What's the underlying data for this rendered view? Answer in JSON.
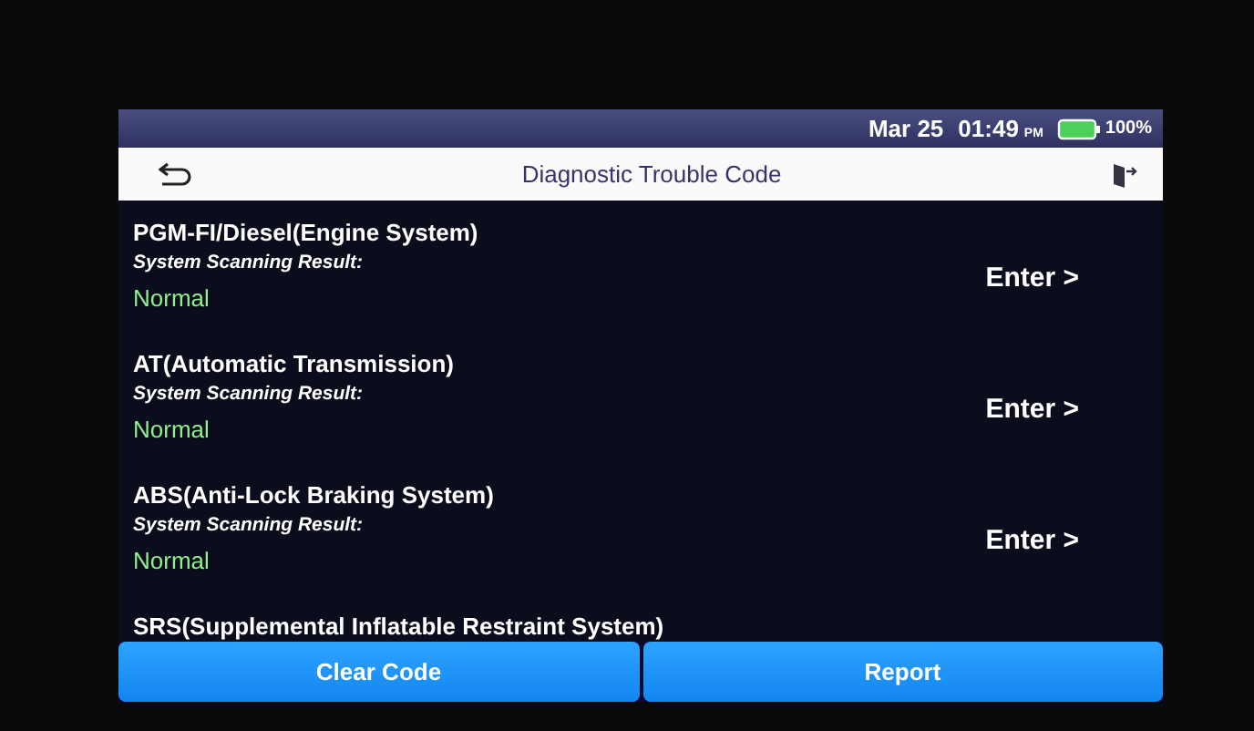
{
  "status_bar": {
    "date": "Mar 25",
    "time": "01:49",
    "meridiem": "PM",
    "battery_level": "100%"
  },
  "header": {
    "title": "Diagnostic Trouble Code"
  },
  "systems": [
    {
      "name": "PGM-FI/Diesel(Engine System)",
      "result_label": "System Scanning Result:",
      "result": "Normal",
      "action": "Enter >"
    },
    {
      "name": "AT(Automatic Transmission)",
      "result_label": "System Scanning Result:",
      "result": "Normal",
      "action": "Enter >"
    },
    {
      "name": "ABS(Anti-Lock Braking System)",
      "result_label": "System Scanning Result:",
      "result": "Normal",
      "action": "Enter >"
    },
    {
      "name": "SRS(Supplemental Inflatable Restraint System)"
    }
  ],
  "buttons": [
    "Clear Code",
    "Report"
  ]
}
